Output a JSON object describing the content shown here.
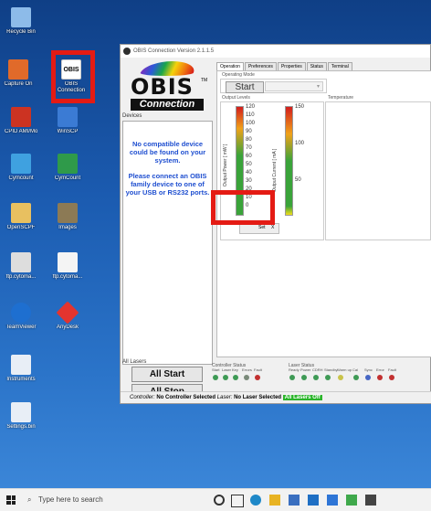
{
  "desktop": {
    "icons": [
      {
        "label": "Recycle Bin",
        "color": "#7fb2e8"
      },
      {
        "label": "Capture On",
        "color": "#e06a2a"
      },
      {
        "label": "OBIS Connection",
        "color": "#ffffff"
      },
      {
        "label": "CPID AMI/Monitor",
        "color": "#cc3322"
      },
      {
        "label": "WinSCP",
        "color": "#3b7bd4"
      },
      {
        "label": "Cymcount",
        "color": "#3fa1e0"
      },
      {
        "label": "CymCount",
        "color": "#2f9a4a"
      },
      {
        "label": "OpenSCPF",
        "color": "#e8c060"
      },
      {
        "label": "Images",
        "color": "#8c7a55"
      },
      {
        "label": "ftp.cytoma...",
        "color": "#dddddd"
      },
      {
        "label": "ftp.cytoma...",
        "color": "#f4f4f4"
      },
      {
        "label": "TeamViewer",
        "color": "#1e6fd0"
      },
      {
        "label": "AnyDesk",
        "color": "#e3342f"
      },
      {
        "label": "Instruments",
        "color": "#e8eef6"
      },
      {
        "label": "Settings.bin",
        "color": "#e8eef6"
      }
    ]
  },
  "window": {
    "title": "OBIS Connection Version 2.1.1.5"
  },
  "left": {
    "logo_text": "OBIS",
    "logo_sub": "Connection",
    "tm": "TM",
    "devices_label": "Devices",
    "no_device_msg": "No compatible device could be found on your system.",
    "connect_msg": "Please connect an OBIS family device to one of your USB or RS232 ports.",
    "all_lasers_label": "All Lasers",
    "all_start": "All Start",
    "all_stop": "All Stop"
  },
  "tabs": [
    "Operation",
    "Preferences",
    "Properties",
    "Status",
    "Terminal"
  ],
  "operation": {
    "operating_mode_label": "Operating Mode",
    "start_button": "Start",
    "dropdown_arrow": "▾",
    "output_levels_label": "Output Levels",
    "temperature_label": "Temperature",
    "power_ticks": [
      "120",
      "110",
      "100",
      "90",
      "80",
      "70",
      "60",
      "50",
      "40",
      "30",
      "20",
      "10",
      "0"
    ],
    "current_ticks": [
      "150",
      "100",
      "50"
    ],
    "output_power_label": "Output Power [ mW ]",
    "output_current_label": "Output Current [ mA ]",
    "set_label": "Set",
    "x_label": "X"
  },
  "controller_status": {
    "label": "Controller Status",
    "items": [
      "Start",
      "Laser",
      "Key",
      "Errors",
      "Fault"
    ]
  },
  "laser_status": {
    "label": "Laser Status",
    "items": [
      "Ready",
      "Power",
      "CDRH",
      "Standby",
      "Warm up",
      "Cal",
      "Sync",
      "Error",
      "Fault"
    ]
  },
  "statusbar": {
    "controller_label": "Controller:",
    "controller_value": "No Controller Selected",
    "laser_label": "Laser:",
    "laser_value": "No Laser Selected",
    "all_lasers": "All Lasers Off"
  },
  "taskbar": {
    "search_placeholder": "Type here to search"
  }
}
